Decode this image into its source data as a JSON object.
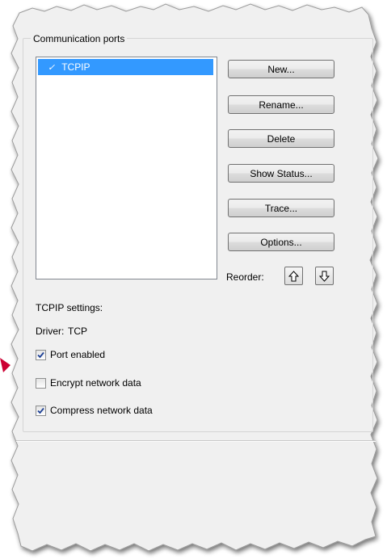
{
  "group": {
    "title": "Communication ports"
  },
  "ports": [
    {
      "label": "TCPIP",
      "enabled": true,
      "selected": true
    }
  ],
  "buttons": {
    "new": "New...",
    "rename": "Rename...",
    "delete": "Delete",
    "show_status": "Show Status...",
    "trace": "Trace...",
    "options": "Options..."
  },
  "reorder": {
    "label": "Reorder:",
    "up_icon": "arrow-up-icon",
    "down_icon": "arrow-down-icon"
  },
  "settings": {
    "heading": "TCPIP settings:",
    "driver_label": "Driver:",
    "driver_value": "TCP"
  },
  "checkboxes": [
    {
      "label": "Port enabled",
      "checked": true
    },
    {
      "label": "Encrypt network data",
      "checked": false
    },
    {
      "label": "Compress network data",
      "checked": true
    }
  ],
  "colors": {
    "selection": "#3399ff",
    "dialog_bg": "#f0f0f0",
    "callout_arrow": "#cc0033"
  }
}
